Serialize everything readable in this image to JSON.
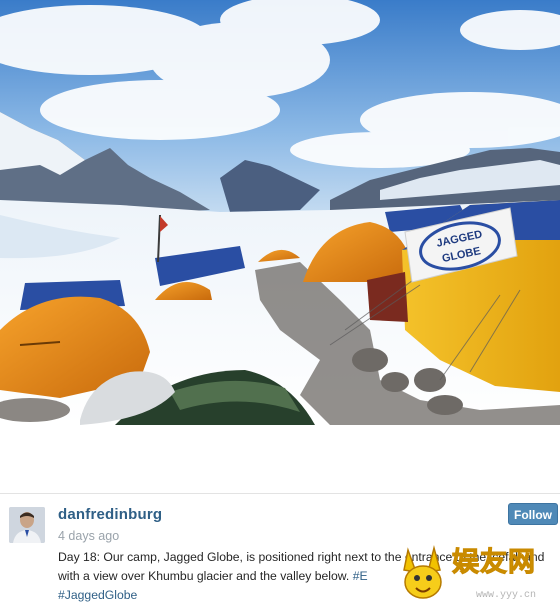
{
  "post": {
    "username": "danfredinburg",
    "time": "4 days ago",
    "follow_label": "Follow",
    "caption_text": "Day 18: Our camp, Jagged Globe, is positioned right next to the entrance to the icefall and with a view over Khumbu glacier and the valley below.",
    "caption_hashtag_1": "#E",
    "caption_hashtag_2": "#JaggedGlobe"
  },
  "photo": {
    "tent_banner_line1": "JAGGED",
    "tent_banner_line2": "GLOBE"
  },
  "watermark": {
    "text": "娱友网",
    "url": "www.yyy.cn"
  },
  "colors": {
    "username": "#2f5f86",
    "hashtag": "#2f5f86",
    "follow_button": "#4f89b7",
    "tent_orange": "#e98a1a",
    "tent_yellow": "#f2b81c",
    "tent_blue": "#2a4ea3"
  }
}
